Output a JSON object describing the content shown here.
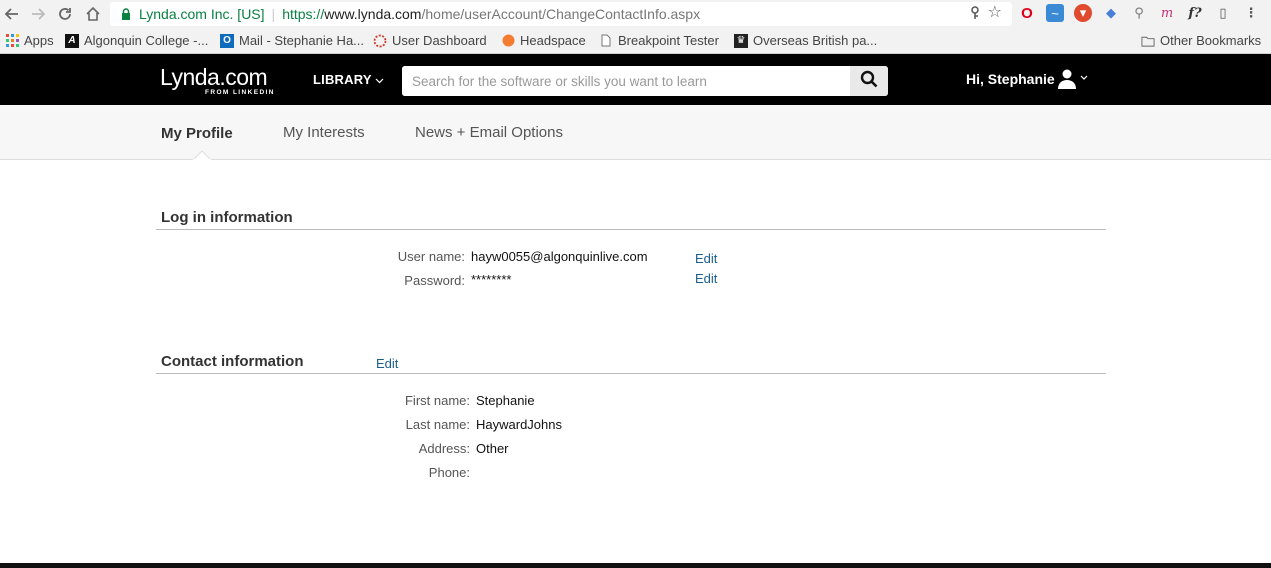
{
  "browser": {
    "secure_label": "Lynda.com Inc. [US]",
    "url_scheme": "https://",
    "url_host": "www.lynda.com",
    "url_path": "/home/userAccount/ChangeContactInfo.aspx",
    "bookmarks": [
      {
        "label": "Apps",
        "icon": "apps-grid-icon"
      },
      {
        "label": "Algonquin College -...",
        "icon": "algonquin-icon"
      },
      {
        "label": "Mail - Stephanie Ha...",
        "icon": "outlook-icon"
      },
      {
        "label": "User Dashboard",
        "icon": "dashboard-icon"
      },
      {
        "label": "Headspace",
        "icon": "headspace-icon"
      },
      {
        "label": "Breakpoint Tester",
        "icon": "page-icon"
      },
      {
        "label": "Overseas British pa...",
        "icon": "crown-icon"
      }
    ],
    "other_bookmarks": "Other Bookmarks"
  },
  "header": {
    "logo_text": "Lynda.com",
    "logo_sub": "FROM LINKEDIN",
    "library_label": "LIBRARY",
    "search_placeholder": "Search for the software or skills you want to learn",
    "greeting": "Hi, Stephanie"
  },
  "tabs": [
    {
      "label": "My Profile",
      "active": true
    },
    {
      "label": "My Interests",
      "active": false
    },
    {
      "label": "News + Email Options",
      "active": false
    }
  ],
  "login": {
    "title": "Log in information",
    "username_label": "User name:",
    "username_value": "hayw0055@algonquinlive.com",
    "password_label": "Password:",
    "password_value": "********",
    "edit_label": "Edit"
  },
  "contact": {
    "title": "Contact information",
    "edit_label": "Edit",
    "first_name_label": "First name:",
    "first_name_value": "Stephanie",
    "last_name_label": "Last name:",
    "last_name_value": "HaywardJohns",
    "address_label": "Address:",
    "address_value": "Other",
    "phone_label": "Phone:",
    "phone_value": ""
  },
  "colors": {
    "header_bg": "#000000",
    "link": "#1a5e8c",
    "secure": "#0b8043"
  }
}
